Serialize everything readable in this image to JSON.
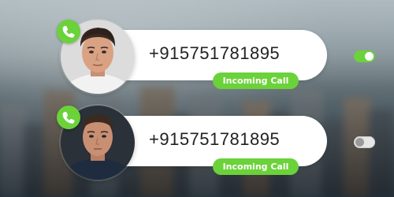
{
  "calls": [
    {
      "phone_number": "+915751781895",
      "status": "Incoming Call",
      "avatar": "man-with-curly-hair-white-shirt",
      "badge_icon": "phone-icon",
      "toggle_state": "on"
    },
    {
      "phone_number": "+915751781895",
      "status": "Incoming Call",
      "avatar": "man-with-short-hair-navy-shirt",
      "badge_icon": "phone-icon",
      "toggle_state": "off"
    }
  ],
  "colors": {
    "accent_green": "#6bd23a",
    "card_background": "#ffffff",
    "number_text": "#222222",
    "toggle_off": "#e6e6e6"
  }
}
